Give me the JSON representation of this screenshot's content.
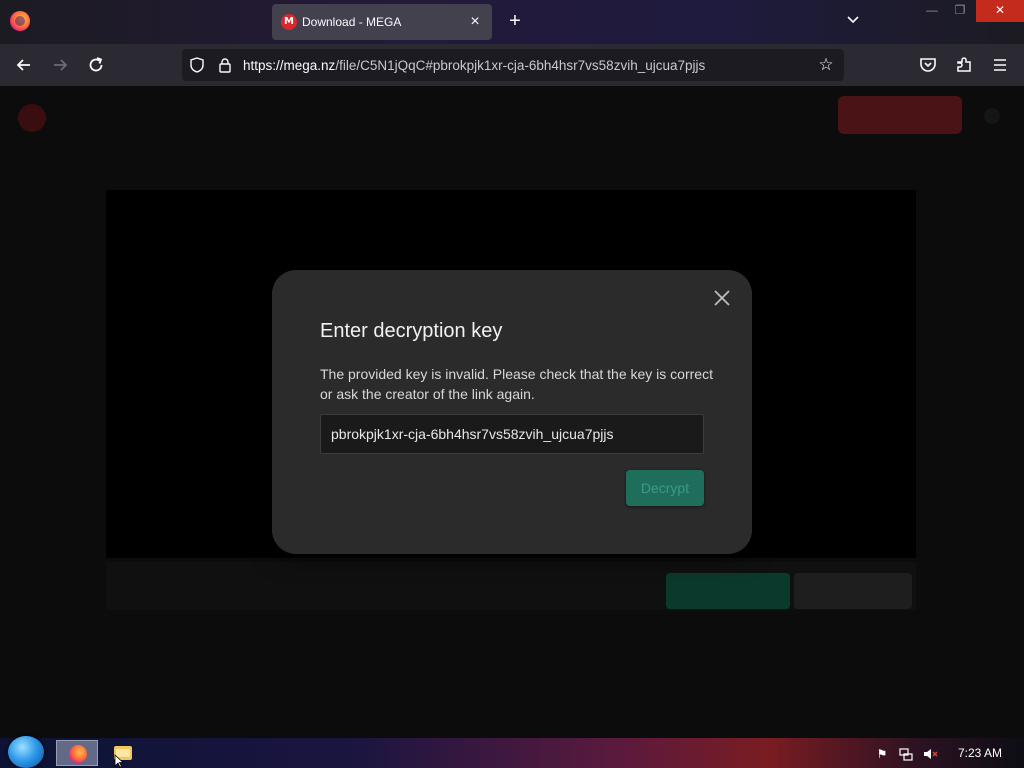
{
  "browser": {
    "tab": {
      "title": "Download - MEGA",
      "favicon_letter": "M"
    },
    "url": {
      "domain": "https://mega.nz",
      "rest": "/file/C5N1jQqC#pbrokpjk1xr-cja-6bh4hsr7vs58zvih_ujcua7pjjs"
    },
    "icons": {
      "back": "back-arrow-icon",
      "forward": "forward-arrow-icon",
      "reload": "reload-icon",
      "shield": "tracking-shield-icon",
      "lock": "lock-icon",
      "bookmark": "star-icon",
      "pocket": "pocket-icon",
      "extensions": "extensions-icon",
      "menu": "hamburger-menu-icon"
    }
  },
  "modal": {
    "title": "Enter decryption key",
    "message": "The provided key is invalid. Please check that the key is correct or ask the creator of the link again.",
    "key_value": "pbrokpjk1xr-cja-6bh4hsr7vs58zvih_ujcua7pjjs",
    "decrypt_label": "Decrypt"
  },
  "taskbar": {
    "clock": "7:23 AM"
  },
  "colors": {
    "mega_red": "#d9272e",
    "decrypt_green": "#1f6e5c",
    "modal_bg": "#2b2b2b"
  }
}
